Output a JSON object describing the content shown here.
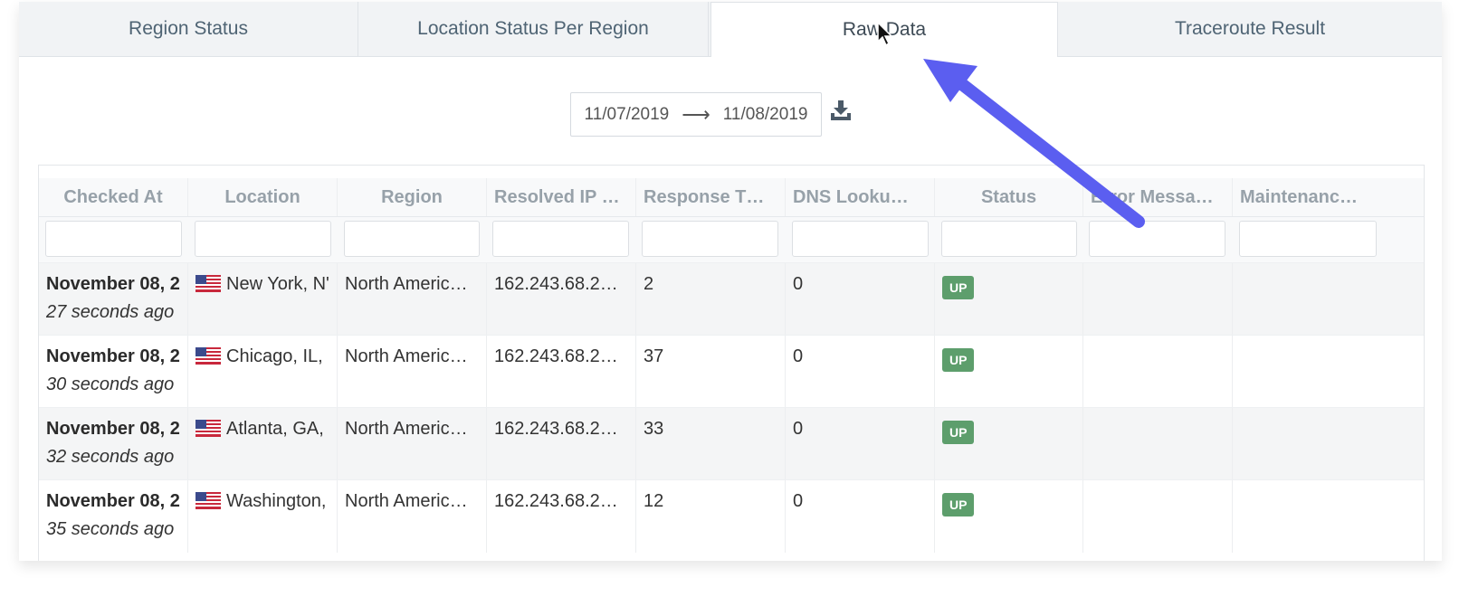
{
  "tabs": [
    {
      "label": "Region Status",
      "active": false
    },
    {
      "label": "Location Status Per Region",
      "active": false
    },
    {
      "label": "Raw Data",
      "active": true
    },
    {
      "label": "Traceroute Result",
      "active": false
    }
  ],
  "date_range": {
    "start": "11/07/2019",
    "arrow": "⟶",
    "end": "11/08/2019"
  },
  "download_icon": "download-icon",
  "table": {
    "columns": [
      "Checked At",
      "Location",
      "Region",
      "Resolved IP …",
      "Response T…",
      "DNS Looku…",
      "Status",
      "Error Messa…",
      "Maintenanc…"
    ],
    "rows": [
      {
        "checked_at": "November 08, 2",
        "ago": "27 seconds ago",
        "location": "New York, N'",
        "region": "North Americ…",
        "ip": "162.243.68.2…",
        "response": "2",
        "dns": "0",
        "status": "UP"
      },
      {
        "checked_at": "November 08, 2",
        "ago": "30 seconds ago",
        "location": "Chicago, IL,",
        "region": "North Americ…",
        "ip": "162.243.68.2…",
        "response": "37",
        "dns": "0",
        "status": "UP"
      },
      {
        "checked_at": "November 08, 2",
        "ago": "32 seconds ago",
        "location": "Atlanta, GA,",
        "region": "North Americ…",
        "ip": "162.243.68.2…",
        "response": "33",
        "dns": "0",
        "status": "UP"
      },
      {
        "checked_at": "November 08, 2",
        "ago": "35 seconds ago",
        "location": "Washington,",
        "region": "North Americ…",
        "ip": "162.243.68.2…",
        "response": "12",
        "dns": "0",
        "status": "UP"
      }
    ]
  },
  "colors": {
    "status_up": "#5d9e6c",
    "annotation_arrow": "#5b5ef0",
    "header_text": "#97a1a9"
  }
}
